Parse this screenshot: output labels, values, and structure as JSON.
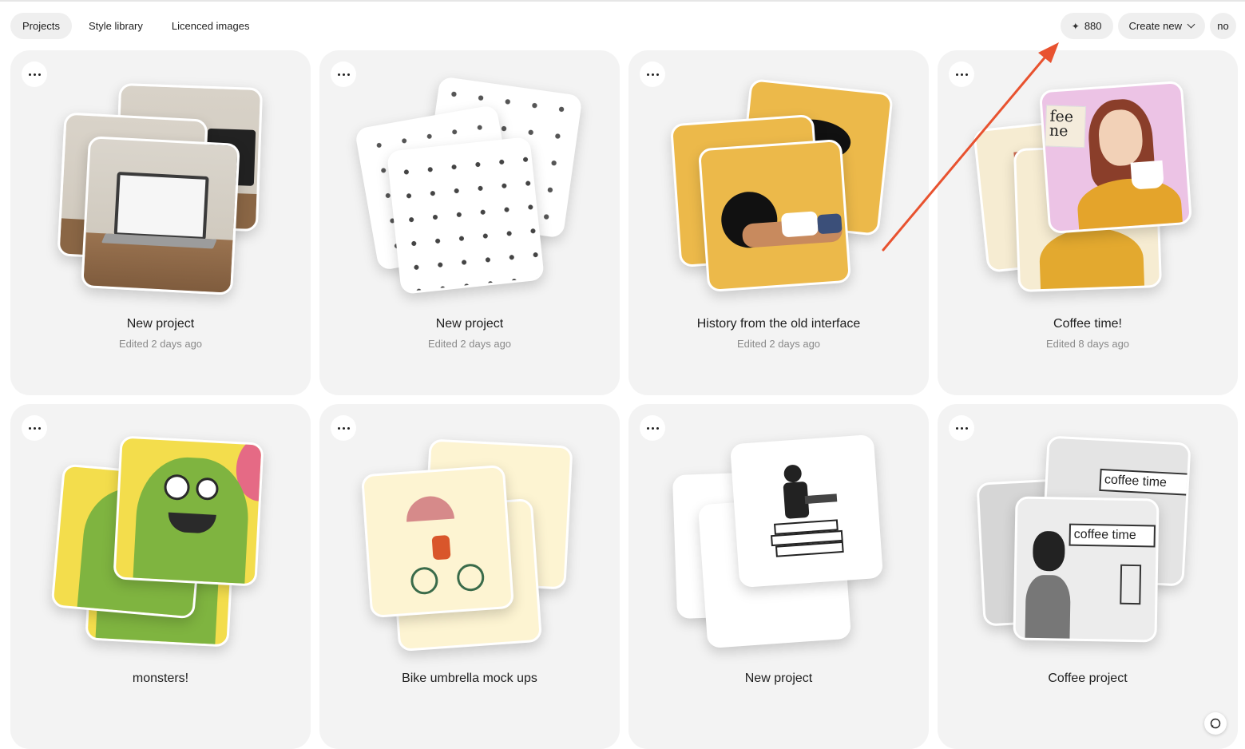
{
  "nav": {
    "tabs": [
      {
        "label": "Projects",
        "active": true
      },
      {
        "label": "Style library",
        "active": false
      },
      {
        "label": "Licenced images",
        "active": false
      }
    ]
  },
  "header": {
    "credits_icon": "sparkle-icon",
    "credits": "880",
    "create_new_label": "Create new",
    "avatar_initials": "no"
  },
  "projects": [
    {
      "title": "New project",
      "edited": "Edited 2 days ago",
      "theme": "laptop"
    },
    {
      "title": "New project",
      "edited": "Edited 2 days ago",
      "theme": "pattern"
    },
    {
      "title": "History from the old interface",
      "edited": "Edited 2 days ago",
      "theme": "yellow-girl"
    },
    {
      "title": "Coffee time!",
      "edited": "Edited 8 days ago",
      "theme": "coffee-woman"
    },
    {
      "title": "monsters!",
      "edited": "",
      "theme": "monster"
    },
    {
      "title": "Bike umbrella mock ups",
      "edited": "",
      "theme": "bike"
    },
    {
      "title": "New project",
      "edited": "",
      "theme": "reader"
    },
    {
      "title": "Coffee project",
      "edited": "",
      "theme": "coffee-shop"
    }
  ],
  "thumb_text": {
    "coffee_sign": "fee\nne",
    "coffee_time": "coffee time"
  },
  "colors": {
    "annotation_arrow": "#e8522f",
    "card_bg": "#f3f3f3",
    "pill_bg": "#efefef"
  }
}
